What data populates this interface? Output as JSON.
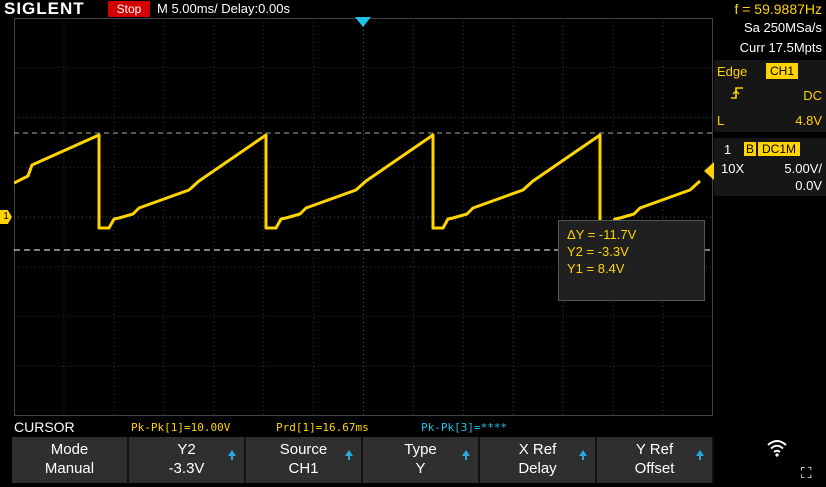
{
  "brand": "SIGLENT",
  "run_state": "Stop",
  "timebase": "M 5.00ms/ Delay:0.00s",
  "frequency": "f = 59.9887Hz",
  "acquisition": {
    "sample_rate": "Sa 250MSa/s",
    "memory": "Curr 17.5Mpts"
  },
  "trigger": {
    "type": "Edge",
    "source": "CH1",
    "coupling": "DC",
    "level_label": "L",
    "level": "4.8V"
  },
  "channel": {
    "number": "1",
    "bw_flag": "B",
    "coupling": "DC1M",
    "probe": "10X",
    "scale": "5.00V/",
    "offset": "0.0V"
  },
  "channel_marker": "1",
  "cursor_readout": {
    "delta_y": "ΔY = -11.7V",
    "y2": "Y2 = -3.3V",
    "y1": "Y1 = 8.4V"
  },
  "menu_title": "CURSOR",
  "measurements": [
    {
      "text": "Pk-Pk[1]=10.00V",
      "color": "#ffd400"
    },
    {
      "text": "Prd[1]=16.67ms",
      "color": "#ffd400"
    },
    {
      "text": "Pk-Pk[3]=****",
      "color": "#1ec4e8"
    }
  ],
  "softkeys": [
    {
      "name": "mode",
      "line1": "Mode",
      "line2": "Manual",
      "has_arrow": false
    },
    {
      "name": "y2",
      "line1": "Y2",
      "line2": "-3.3V",
      "has_arrow": true
    },
    {
      "name": "source",
      "line1": "Source",
      "line2": "CH1",
      "has_arrow": true
    },
    {
      "name": "type",
      "line1": "Type",
      "line2": "Y",
      "has_arrow": true
    },
    {
      "name": "x-ref",
      "line1": "X Ref",
      "line2": "Delay",
      "has_arrow": true
    },
    {
      "name": "y-ref",
      "line1": "Y Ref",
      "line2": "Offset",
      "has_arrow": true
    }
  ],
  "colors": {
    "ch1": "#ffd400",
    "trigger": "#1ec4e8",
    "stop": "#d40000",
    "accent": "#2aa7e0"
  },
  "icons": [
    "wifi-icon",
    "expand-icon",
    "trigger-rising-edge-icon"
  ]
}
